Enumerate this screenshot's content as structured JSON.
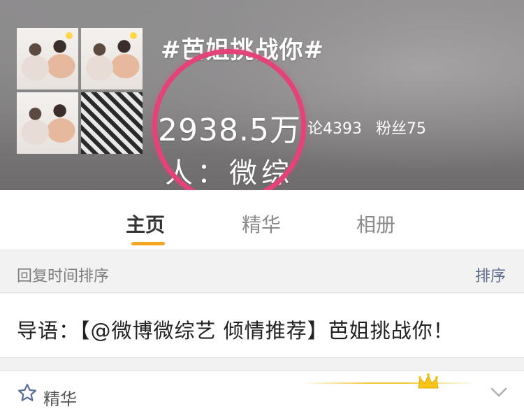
{
  "header": {
    "title": "#芭姐挑战你#",
    "read_count": "2938.5万",
    "comment_count": "论4393",
    "fans_count": "粉丝75",
    "host_text": "人：微综"
  },
  "tabs": [
    {
      "label": "主页",
      "active": true
    },
    {
      "label": "精华",
      "active": false
    },
    {
      "label": "相册",
      "active": false
    }
  ],
  "sort_bar": {
    "label": "回复时间排序",
    "button": "排序"
  },
  "intro": {
    "text": "导语：【@微博微综艺 倾情推荐】芭姐挑战你！"
  },
  "bottom": {
    "label": "精华"
  },
  "colors": {
    "accent_orange": "#f5a623",
    "highlight_ring": "#e4437a",
    "link_blue": "#5b6a8a"
  }
}
